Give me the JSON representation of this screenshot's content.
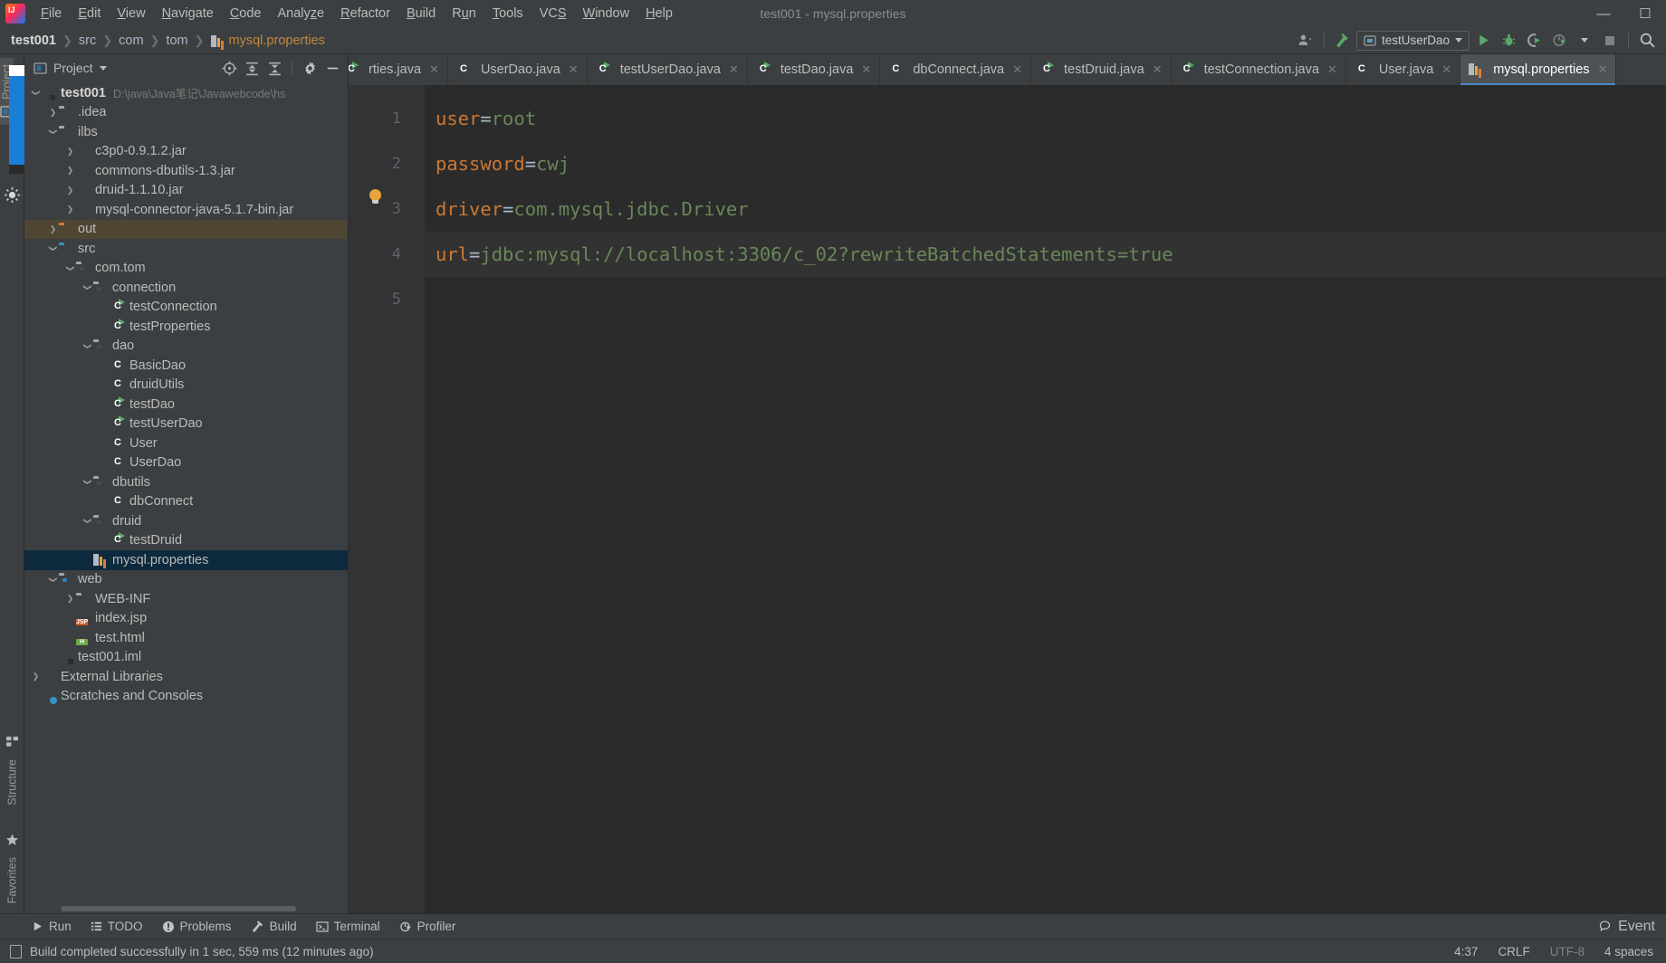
{
  "window": {
    "title": "test001 - mysql.properties",
    "minimize": "—",
    "maximize": "☐"
  },
  "menu": {
    "items": [
      "File",
      "Edit",
      "View",
      "Navigate",
      "Code",
      "Analyze",
      "Refactor",
      "Build",
      "Run",
      "Tools",
      "VCS",
      "Window",
      "Help"
    ]
  },
  "breadcrumb": {
    "items": [
      "test001",
      "src",
      "com",
      "tom"
    ],
    "file": "mysql.properties",
    "separator": "❯"
  },
  "toolbar": {
    "run_config": "testUserDao",
    "search_icon": "search-icon",
    "run_icon": "run-icon",
    "debug_icon": "debug-icon",
    "coverage_icon": "run-with-coverage-icon",
    "profile_icon": "profiler-icon",
    "stop_icon": "stop-icon",
    "user_icon": "user-icon",
    "build_icon": "build-hammer-icon"
  },
  "stripe": {
    "left_top": [
      {
        "label": "Project",
        "selected": true
      }
    ],
    "left_bottom": [
      {
        "label": "Structure",
        "selected": false
      },
      {
        "label": "Favorites",
        "selected": false
      }
    ]
  },
  "project_panel": {
    "title": "Project",
    "tools": [
      "locate-icon",
      "expand-all-icon",
      "collapse-all-icon",
      "gear-icon",
      "hide-icon"
    ],
    "tree": [
      {
        "indent": 0,
        "arrow": "down",
        "icon": "module",
        "label": "test001",
        "bold": true,
        "sub": "D:\\java\\Java笔记\\Javawebcode\\hs"
      },
      {
        "indent": 1,
        "arrow": "right",
        "icon": "folder",
        "label": ".idea"
      },
      {
        "indent": 1,
        "arrow": "down",
        "icon": "folder",
        "label": "ilbs"
      },
      {
        "indent": 2,
        "arrow": "right",
        "icon": "jar",
        "label": "c3p0-0.9.1.2.jar"
      },
      {
        "indent": 2,
        "arrow": "right",
        "icon": "jar",
        "label": "commons-dbutils-1.3.jar"
      },
      {
        "indent": 2,
        "arrow": "right",
        "icon": "jar",
        "label": "druid-1.1.10.jar"
      },
      {
        "indent": 2,
        "arrow": "right",
        "icon": "jar",
        "label": "mysql-connector-java-5.1.7-bin.jar"
      },
      {
        "indent": 1,
        "arrow": "right",
        "icon": "folder-orange",
        "label": "out",
        "highlight": true
      },
      {
        "indent": 1,
        "arrow": "down",
        "icon": "folder-blue",
        "label": "src"
      },
      {
        "indent": 2,
        "arrow": "down",
        "icon": "package",
        "label": "com.tom"
      },
      {
        "indent": 3,
        "arrow": "down",
        "icon": "package",
        "label": "connection"
      },
      {
        "indent": 4,
        "arrow": "none",
        "icon": "class-runnable",
        "label": "testConnection"
      },
      {
        "indent": 4,
        "arrow": "none",
        "icon": "class-runnable",
        "label": "testProperties"
      },
      {
        "indent": 3,
        "arrow": "down",
        "icon": "package",
        "label": "dao"
      },
      {
        "indent": 4,
        "arrow": "none",
        "icon": "class",
        "label": "BasicDao"
      },
      {
        "indent": 4,
        "arrow": "none",
        "icon": "class",
        "label": "druidUtils"
      },
      {
        "indent": 4,
        "arrow": "none",
        "icon": "class-runnable",
        "label": "testDao"
      },
      {
        "indent": 4,
        "arrow": "none",
        "icon": "class-runnable",
        "label": "testUserDao"
      },
      {
        "indent": 4,
        "arrow": "none",
        "icon": "class",
        "label": "User"
      },
      {
        "indent": 4,
        "arrow": "none",
        "icon": "class",
        "label": "UserDao"
      },
      {
        "indent": 3,
        "arrow": "down",
        "icon": "package",
        "label": "dbutils"
      },
      {
        "indent": 4,
        "arrow": "none",
        "icon": "class",
        "label": "dbConnect"
      },
      {
        "indent": 3,
        "arrow": "down",
        "icon": "package",
        "label": "druid"
      },
      {
        "indent": 4,
        "arrow": "none",
        "icon": "class-runnable",
        "label": "testDruid"
      },
      {
        "indent": 3,
        "arrow": "none",
        "icon": "properties",
        "label": "mysql.properties",
        "selected": true
      },
      {
        "indent": 1,
        "arrow": "down",
        "icon": "package-src",
        "label": "web"
      },
      {
        "indent": 2,
        "arrow": "right",
        "icon": "folder",
        "label": "WEB-INF"
      },
      {
        "indent": 2,
        "arrow": "none",
        "icon": "jsp",
        "label": "index.jsp"
      },
      {
        "indent": 2,
        "arrow": "none",
        "icon": "html",
        "label": "test.html"
      },
      {
        "indent": 1,
        "arrow": "none",
        "icon": "iml",
        "label": "test001.iml"
      },
      {
        "indent": 0,
        "arrow": "right",
        "icon": "external-libraries",
        "label": "External Libraries"
      },
      {
        "indent": 0,
        "arrow": "none",
        "icon": "scratches",
        "label": "Scratches and Consoles"
      }
    ]
  },
  "tabs": [
    {
      "label": "rties.java",
      "icon": "class-runnable",
      "active": false,
      "clipped": true
    },
    {
      "label": "UserDao.java",
      "icon": "class",
      "active": false
    },
    {
      "label": "testUserDao.java",
      "icon": "class-runnable",
      "active": false
    },
    {
      "label": "testDao.java",
      "icon": "class-runnable",
      "active": false
    },
    {
      "label": "dbConnect.java",
      "icon": "class",
      "active": false
    },
    {
      "label": "testDruid.java",
      "icon": "class-runnable",
      "active": false
    },
    {
      "label": "testConnection.java",
      "icon": "class-runnable",
      "active": false
    },
    {
      "label": "User.java",
      "icon": "class",
      "active": false
    },
    {
      "label": "mysql.properties",
      "icon": "properties",
      "active": true
    }
  ],
  "tab_close": "✕",
  "editor": {
    "line_numbers": [
      "1",
      "2",
      "3",
      "4",
      "5"
    ],
    "current_line": 4,
    "lines": [
      {
        "key": "user",
        "eq": "=",
        "value": "root"
      },
      {
        "key": "password",
        "eq": "=",
        "value": "cwj"
      },
      {
        "key": "driver",
        "eq": "=",
        "value": "com.mysql.jdbc.Driver"
      },
      {
        "key": "url",
        "eq": "=",
        "value": "jdbc:mysql://localhost:3306/c_02?rewriteBatchedStatements=true"
      },
      {
        "key": "",
        "eq": "",
        "value": ""
      }
    ],
    "colors": {
      "key": "#cc7832",
      "value": "#6a8759",
      "background": "#2b2b2b",
      "gutter": "#313335"
    }
  },
  "bottom_tools": [
    {
      "label": "Run",
      "icon": "run-icon"
    },
    {
      "label": "TODO",
      "icon": "todo-icon"
    },
    {
      "label": "Problems",
      "icon": "problems-icon"
    },
    {
      "label": "Build",
      "icon": "build-icon"
    },
    {
      "label": "Terminal",
      "icon": "terminal-icon"
    },
    {
      "label": "Profiler",
      "icon": "profiler-icon"
    }
  ],
  "bottom_right": {
    "label": "Event",
    "icon": "event-log-icon"
  },
  "statusbar": {
    "message": "Build completed successfully in 1 sec, 559 ms (12 minutes ago)",
    "caret": "4:37",
    "line_separator": "CRLF",
    "encoding": "UTF-8",
    "indent": "4 spaces"
  }
}
